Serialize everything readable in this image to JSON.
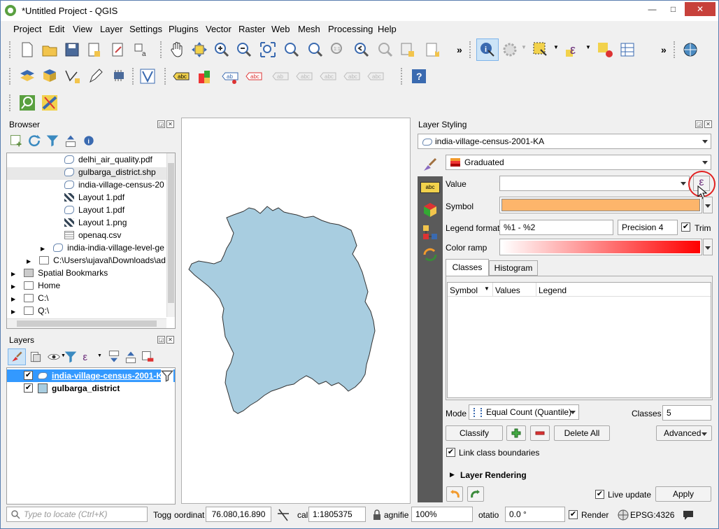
{
  "window": {
    "title": "*Untitled Project - QGIS",
    "min": "—",
    "max": "□",
    "close": "✕"
  },
  "menu": [
    "Project",
    "Edit",
    "View",
    "Layer",
    "Settings",
    "Plugins",
    "Vector",
    "Raster",
    "Web",
    "Mesh",
    "Processing",
    "Help"
  ],
  "toolbar": {
    "overflow1": "»",
    "overflow2": "»"
  },
  "browser": {
    "title": "Browser",
    "items": [
      {
        "label": "delhi_air_quality.pdf",
        "type": "shp"
      },
      {
        "label": "gulbarga_district.shp",
        "type": "shp"
      },
      {
        "label": "india-village-census-20",
        "type": "shp"
      },
      {
        "label": "Layout 1.pdf",
        "type": "raster"
      },
      {
        "label": "Layout 1.pdf",
        "type": "shp"
      },
      {
        "label": "Layout 1.png",
        "type": "raster"
      },
      {
        "label": "openaq.csv",
        "type": "csv"
      },
      {
        "label": "india-india-village-level-ge",
        "type": "shp"
      },
      {
        "label": "C:\\Users\\ujaval\\Downloads\\ad",
        "type": "folder"
      },
      {
        "label": "Spatial Bookmarks",
        "type": "bookmark"
      },
      {
        "label": "Home",
        "type": "home"
      },
      {
        "label": "C:\\",
        "type": "drive"
      },
      {
        "label": "Q:\\",
        "type": "drive"
      }
    ]
  },
  "layers": {
    "title": "Layers",
    "items": [
      {
        "label": "india-village-census-2001-K",
        "checked": true,
        "selected": true
      },
      {
        "label": "gulbarga_district",
        "checked": true,
        "selected": false
      }
    ]
  },
  "styling": {
    "title": "Layer Styling",
    "layer": "india-village-census-2001-KA",
    "renderer": "Graduated",
    "value_label": "Value",
    "value": "",
    "expr_icon": "ε",
    "symbol_label": "Symbol",
    "symbol_color": "#fdb56b",
    "legend_format_label": "Legend format",
    "legend_format": "%1 - %2",
    "precision": "Precision 4",
    "trim_label": "Trim",
    "trim_checked": true,
    "color_ramp_label": "Color ramp",
    "tabs": [
      "Classes",
      "Histogram"
    ],
    "columns": [
      "Symbol",
      "Values",
      "Legend"
    ],
    "mode_label": "Mode",
    "mode": "Equal Count (Quantile)",
    "classes_label": "Classes",
    "classes": "5",
    "classify": "Classify",
    "delete_all": "Delete All",
    "advanced": "Advanced",
    "link_label": "Link class boundaries",
    "layer_rendering": "Layer Rendering",
    "live_update": "Live update",
    "apply": "Apply"
  },
  "status": {
    "locate_placeholder": "Type to locate (Ctrl+K)",
    "toggle": "Togg",
    "coord_label": "oordinat",
    "coord": "76.080,16.890",
    "scale_label": "cal",
    "scale": "1:1805375",
    "magnifier_label": "agnifie",
    "magnifier": "100%",
    "rotation_label": "otatio",
    "rotation": "0.0 °",
    "render": "Render",
    "crs": "EPSG:4326"
  },
  "colors": {
    "accent": "#3399ff",
    "selection": "#cce8ff",
    "polygon_fill": "#a8cde0",
    "ramp_end": "#ff0000"
  }
}
